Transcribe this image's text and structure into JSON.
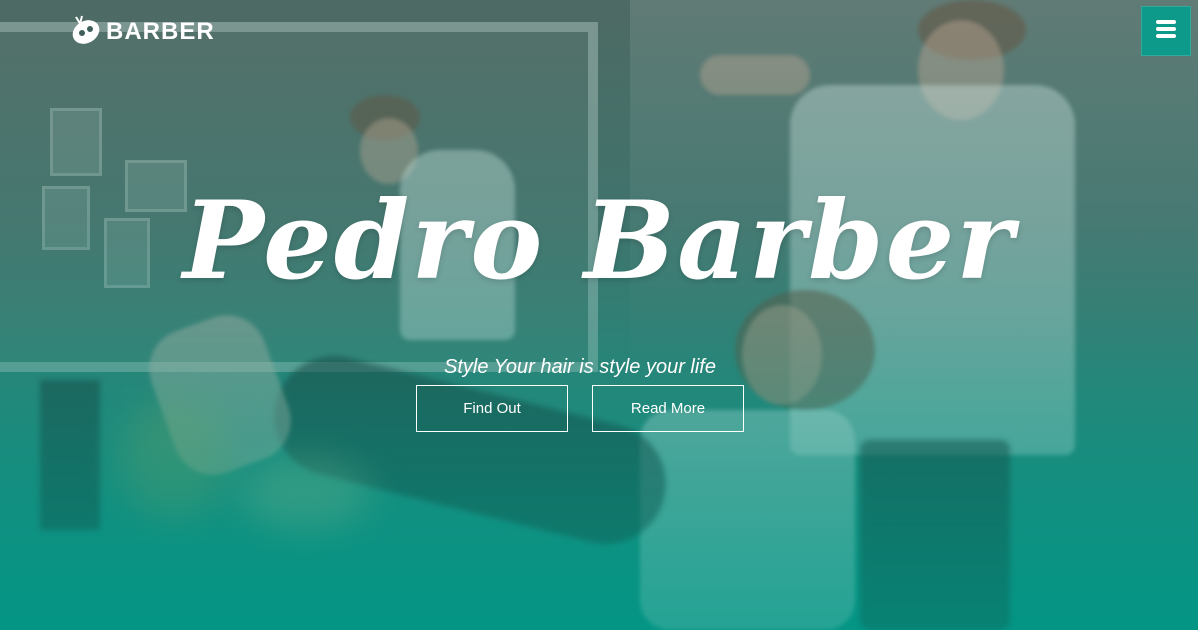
{
  "header": {
    "logo_text": "BARBER",
    "logo_icon": "barber-logo-icon",
    "menu_icon": "hamburger-menu-icon"
  },
  "hero": {
    "title": "Pedro Barber",
    "subtitle": "Style Your hair is style your life",
    "buttons": [
      {
        "label": "Find Out"
      },
      {
        "label": "Read More"
      }
    ]
  },
  "colors": {
    "accent": "#0d9a8a",
    "overlay_bottom": "#009684",
    "text": "#ffffff"
  }
}
